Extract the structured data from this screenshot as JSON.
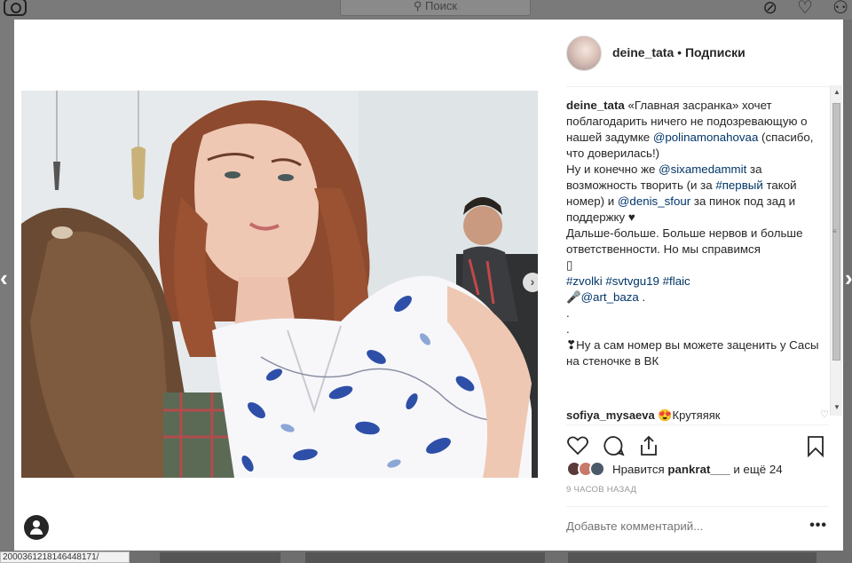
{
  "background": {
    "search_placeholder": "Поиск",
    "status_url": "2000361218146448171/"
  },
  "post": {
    "author": "deine_tata",
    "follow_label": "Подписки",
    "header_separator": "•",
    "caption_intro": "«Главная засранка» хочет поблагодарить ничего не подозревающую о нашей задумке ",
    "mention1": "@polinamonahovaa",
    "caption_part2": " (спасибо, что доверилась!)\nНу и конечно же ",
    "mention2": "@sixamedammit",
    "caption_part3": " за возможность творить (и за ",
    "hashtag1": "#первый",
    "caption_part4": " такой номер) и ",
    "mention3": "@denis_sfour",
    "caption_part5": " за пинок под зад и поддержку ♥\nДальше-больше. Больше нервов и больше ответственности. Но мы справимся\n▯\n",
    "hashtags": "#zvolki #svtvgu19 #flaic",
    "caption_part6": "\n🎤",
    "mention4": "@art_baza",
    "caption_part7": " .\n.\n.\n❣Ну а сам номер вы можете заценить у Сасы на стеночке в ВК",
    "reply_user": "sofiya_mysaeva",
    "reply_text": "😍Крутяяяк",
    "likes_prefix": "Нравится",
    "likes_user": "pankrat___",
    "likes_suffix": "и ещё 24",
    "timestamp": "9 ЧАСОВ НАЗАД",
    "comment_placeholder": "Добавьте комментарий...",
    "more_label": "•••"
  },
  "icons": {
    "like": "heart-icon",
    "comment": "comment-icon",
    "share": "share-icon",
    "save": "bookmark-icon"
  },
  "colors": {
    "link": "#003569",
    "text": "#262626",
    "muted": "#999999"
  }
}
